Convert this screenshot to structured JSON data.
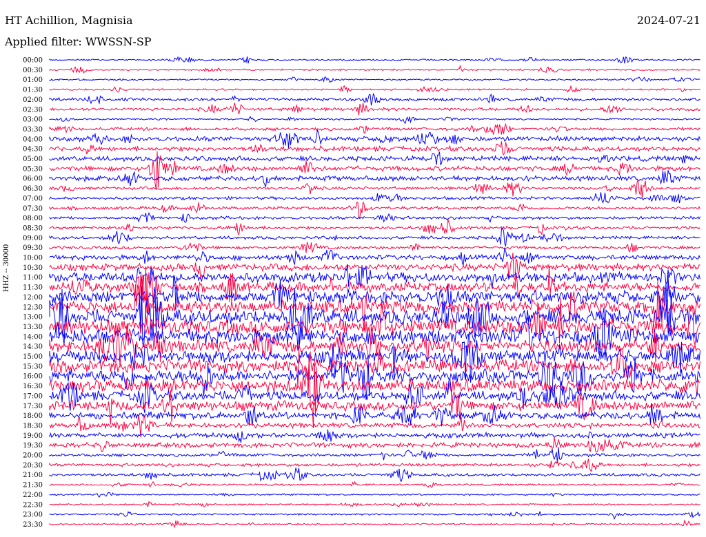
{
  "header": {
    "station": "HT Achillion, Magnisia",
    "date": "2024-07-21",
    "filter": "Applied filter: WWSSN-SP"
  },
  "chart_data": {
    "type": "line",
    "title": "HT Achillion, Magnisia",
    "ylabel": "HHZ -- 30000",
    "time_labels": [
      "00:00",
      "00:30",
      "01:00",
      "01:30",
      "02:00",
      "02:30",
      "03:00",
      "03:30",
      "04:00",
      "04:30",
      "05:00",
      "05:30",
      "06:00",
      "06:30",
      "07:00",
      "07:30",
      "08:00",
      "08:30",
      "09:00",
      "09:30",
      "10:00",
      "10:30",
      "11:00",
      "11:30",
      "12:00",
      "12:30",
      "13:00",
      "13:30",
      "14:00",
      "14:30",
      "15:00",
      "15:30",
      "16:00",
      "16:30",
      "17:00",
      "17:30",
      "18:00",
      "18:30",
      "19:00",
      "19:30",
      "20:00",
      "20:30",
      "21:00",
      "21:30",
      "22:00",
      "22:30",
      "23:00",
      "23:30"
    ],
    "row_colors": [
      "#0000ff",
      "#ff0040"
    ],
    "trace_minutes": 30,
    "activity_levels": [
      1,
      1,
      1,
      1,
      2,
      2,
      1,
      2,
      3,
      3,
      3,
      3,
      3,
      2,
      2,
      2,
      2,
      2,
      2,
      2,
      3,
      4,
      5,
      5,
      6,
      6,
      7,
      7,
      7,
      6,
      6,
      6,
      6,
      6,
      5,
      5,
      4,
      3,
      3,
      3,
      2,
      2,
      2,
      1,
      1,
      1,
      1,
      1
    ]
  }
}
